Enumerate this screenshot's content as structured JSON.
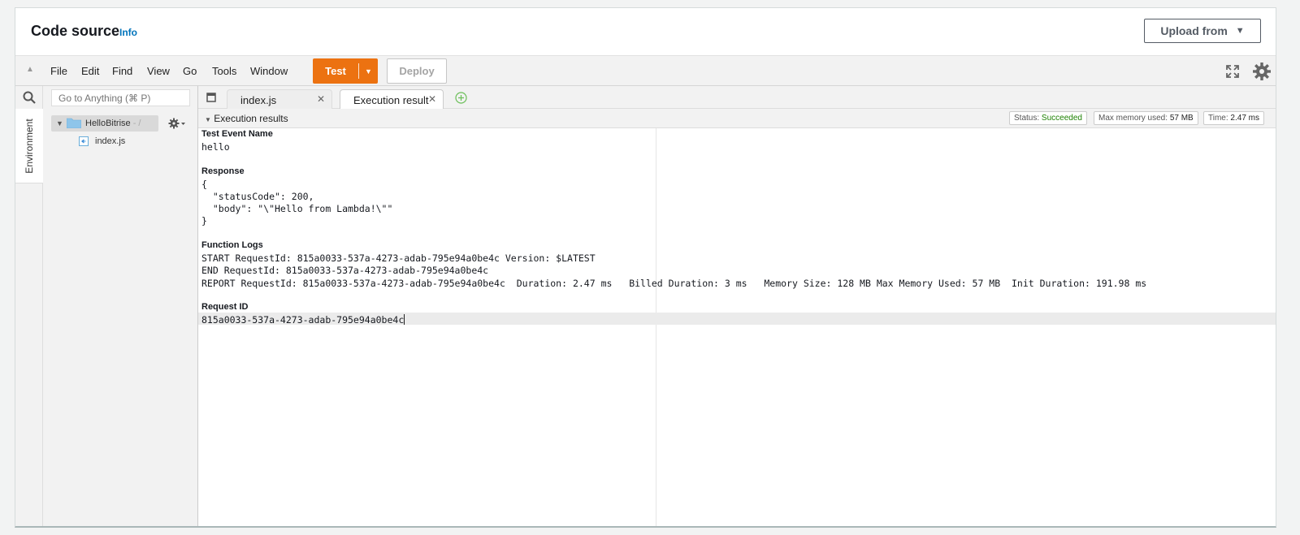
{
  "header": {
    "title": "Code source",
    "info_link": "Info",
    "upload_label": "Upload from"
  },
  "menubar": {
    "items": [
      "File",
      "Edit",
      "Find",
      "View",
      "Go",
      "Tools",
      "Window"
    ],
    "test_label": "Test",
    "deploy_label": "Deploy"
  },
  "sidebar": {
    "search_placeholder": "Go to Anything (⌘ P)",
    "environment_tab": "Environment",
    "folder_name": "HelloBitrise",
    "folder_path": " - /",
    "file_name": "index.js"
  },
  "tabs": [
    {
      "label": "index.js"
    },
    {
      "label": "Execution results"
    }
  ],
  "results": {
    "title": "Execution results",
    "status_label": "Status:",
    "status_value": "Succeeded",
    "memory_label": "Max memory used:",
    "memory_value": "57 MB",
    "time_label": "Time:",
    "time_value": "2.47 ms"
  },
  "output": {
    "event_heading": "Test Event Name",
    "event_name": "hello",
    "response_heading": "Response",
    "response_lines": [
      "{",
      "  \"statusCode\": 200,",
      "  \"body\": \"\\\"Hello from Lambda!\\\"\"",
      "}"
    ],
    "logs_heading": "Function Logs",
    "log_lines": [
      "START RequestId: 815a0033-537a-4273-adab-795e94a0be4c Version: $LATEST",
      "END RequestId: 815a0033-537a-4273-adab-795e94a0be4c",
      "REPORT RequestId: 815a0033-537a-4273-adab-795e94a0be4c  Duration: 2.47 ms   Billed Duration: 3 ms   Memory Size: 128 MB Max Memory Used: 57 MB  Init Duration: 191.98 ms"
    ],
    "request_heading": "Request ID",
    "request_id": "815a0033-537a-4273-adab-795e94a0be4c"
  },
  "colors": {
    "accent_orange": "#ec7211",
    "link_blue": "#0073bb",
    "success_green": "#1d8102"
  },
  "icons": [
    "collapse-icon",
    "fullscreen-icon",
    "gear-icon",
    "search-icon",
    "folder-icon",
    "file-icon",
    "close-icon",
    "add-tab-icon",
    "chevron-down-icon"
  ]
}
